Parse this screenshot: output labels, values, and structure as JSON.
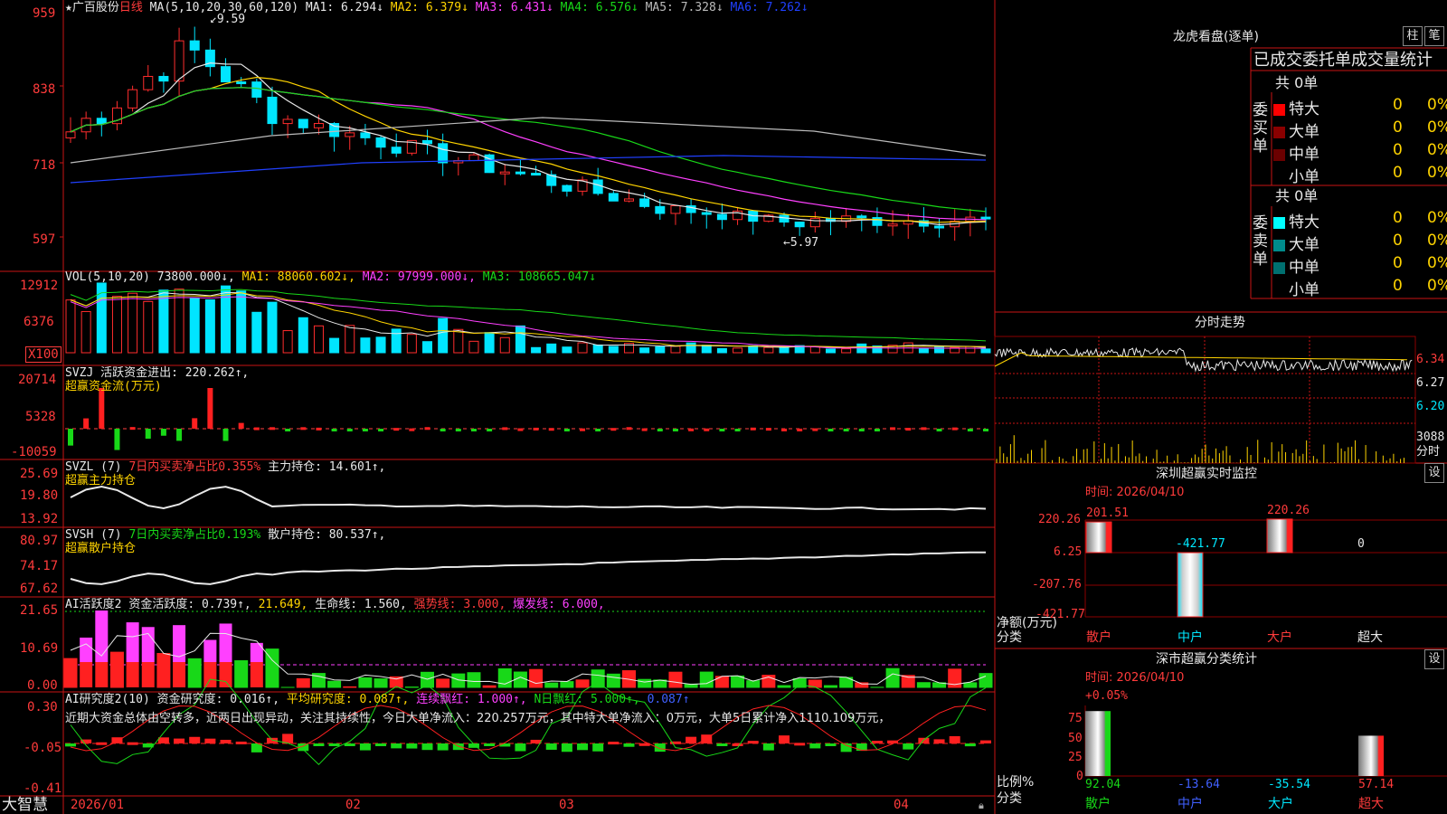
{
  "stock": {
    "name": "★广百股份",
    "period": "日线"
  },
  "main_legend": {
    "ma_label": "MA(5,10,20,30,60,120)",
    "items": [
      {
        "text": "MA1: 6.294↓",
        "color": "#e8e8e8"
      },
      {
        "text": "MA2: 6.379↓",
        "color": "#ffd400"
      },
      {
        "text": "MA3: 6.431↓",
        "color": "#ff40ff"
      },
      {
        "text": "MA4: 6.576↓",
        "color": "#18d818"
      },
      {
        "text": "MA5: 7.328↓",
        "color": "#bbbbbb"
      },
      {
        "text": "MA6: 7.262↓",
        "color": "#2040ff"
      }
    ]
  },
  "price_axis": [
    "959",
    "838",
    "718",
    "597"
  ],
  "price_annotations": {
    "high": "9.59",
    "low": "5.97"
  },
  "vol": {
    "axis": [
      "12912",
      "6376",
      "X100"
    ],
    "legend": [
      {
        "text": "VOL(5,10,20)",
        "color": "#e8e8e8"
      },
      {
        "text": "73800.000↓,",
        "color": "#e8e8e8"
      },
      {
        "text": "MA1: 88060.602↓,",
        "color": "#ffd400"
      },
      {
        "text": "MA2: 97999.000↓,",
        "color": "#ff40ff"
      },
      {
        "text": "MA3: 108665.047↓",
        "color": "#18d818"
      }
    ]
  },
  "svzj": {
    "axis": [
      "20714",
      "5328",
      "-10059"
    ],
    "line1": [
      {
        "text": "SVZJ  活跃资金进出: 220.262↑,",
        "color": "#e8e8e8"
      }
    ],
    "line2": "超赢资金流(万元)"
  },
  "svzl": {
    "axis": [
      "25.69",
      "19.80",
      "13.92"
    ],
    "line1": [
      {
        "text": "SVZL (7)",
        "color": "#e8e8e8"
      },
      {
        "text": "7日内买卖净占比0.355%",
        "color": "#ff3b3b"
      },
      {
        "text": "主力持仓: 14.601↑,",
        "color": "#e8e8e8"
      }
    ],
    "line2": "超赢主力持仓"
  },
  "svsh": {
    "axis": [
      "80.97",
      "74.17",
      "67.62"
    ],
    "line1": [
      {
        "text": "SVSH (7)",
        "color": "#e8e8e8"
      },
      {
        "text": "7日内买卖净占比0.193%",
        "color": "#18d818"
      },
      {
        "text": "散户持仓: 80.537↑,",
        "color": "#e8e8e8"
      }
    ],
    "line2": "超赢散户持仓"
  },
  "ai1": {
    "axis": [
      "21.65",
      "10.69",
      "0.00"
    ],
    "line1": [
      {
        "text": "AI活跃度2",
        "color": "#e8e8e8"
      },
      {
        "text": "资金活跃度: 0.739↑,",
        "color": "#e8e8e8"
      },
      {
        "text": "21.649,",
        "color": "#ffd400"
      },
      {
        "text": "生命线: 1.560,",
        "color": "#e8e8e8"
      },
      {
        "text": "强势线: 3.000,",
        "color": "#ff3b3b"
      },
      {
        "text": "爆发线: 6.000,",
        "color": "#ff40ff"
      }
    ]
  },
  "ai2": {
    "axis": [
      "0.30",
      "-0.05",
      "-0.41"
    ],
    "line1": [
      {
        "text": "AI研究度2(10)",
        "color": "#e8e8e8"
      },
      {
        "text": "资金研究度: 0.016↑,",
        "color": "#e8e8e8"
      },
      {
        "text": "平均研究度: 0.087↑,",
        "color": "#ffd400"
      },
      {
        "text": "连续飘红: 1.000↑,",
        "color": "#ff40ff"
      },
      {
        "text": "N日飘红: 5.000↑,",
        "color": "#18d818"
      },
      {
        "text": "0.087↑",
        "color": "#4060ff"
      }
    ],
    "comment": "近期大资金总体由空转多，近两日出现异动，关注其持续性，今日大单净流入：220.257万元，其中特大单净流入：0万元，大单5日累计净入1110.109万元，"
  },
  "bottom": {
    "brand": "大智慧",
    "dates": [
      "2026/01",
      "02",
      "03",
      "04"
    ]
  },
  "lhb": {
    "title": "龙虎看盘(逐单)",
    "btn1": "柱",
    "btn2": "笔",
    "header": "已成交委托单成交量统计",
    "buy": {
      "total": "共 0单",
      "side": "委买单",
      "rows": [
        {
          "label": "特大",
          "n": "0",
          "p": "0%"
        },
        {
          "label": "大单",
          "n": "0",
          "p": "0%"
        },
        {
          "label": "中单",
          "n": "0",
          "p": "0%"
        },
        {
          "label": "小单",
          "n": "0",
          "p": "0%"
        }
      ]
    },
    "sell": {
      "total": "共 0单",
      "side": "委卖单",
      "rows": [
        {
          "label": "特大",
          "n": "0",
          "p": "0%"
        },
        {
          "label": "大单",
          "n": "0",
          "p": "0%"
        },
        {
          "label": "中单",
          "n": "0",
          "p": "0%"
        },
        {
          "label": "小单",
          "n": "0",
          "p": "0%"
        }
      ]
    },
    "colors": {
      "buy": [
        "#ff0000",
        "#8b0000",
        "#6b0000",
        "#000000"
      ],
      "sell": [
        "#00ffff",
        "#008b8b",
        "#007070",
        "#000000"
      ]
    }
  },
  "intraday": {
    "title": "分时走势",
    "axis": [
      "6.34",
      "6.27",
      "6.20",
      "3088",
      "分时"
    ]
  },
  "sz_monitor": {
    "title": "深圳超赢实时监控",
    "btn": "设",
    "time": "时间: 2026/04/10",
    "axis": [
      "220.26",
      "6.25",
      "-207.76",
      "-421.77"
    ],
    "bars": [
      {
        "cat": "散户",
        "value": 201.51,
        "label": "201.51"
      },
      {
        "cat": "中户",
        "value": -421.77,
        "label": "-421.77"
      },
      {
        "cat": "大户",
        "value": 220.26,
        "label": "220.26"
      },
      {
        "cat": "超大",
        "value": 0,
        "label": "0"
      }
    ],
    "ylabel1": "净额(万元)",
    "ylabel2": "分类"
  },
  "sh_stats": {
    "title": "深市超赢分类统计",
    "btn": "设",
    "time": "时间: 2026/04/10",
    "top_label": "+0.05%",
    "axis": [
      "75",
      "50",
      "25",
      "0"
    ],
    "bars": [
      {
        "cat": "散户",
        "value": 92.04,
        "label": "92.04"
      },
      {
        "cat": "中户",
        "value": -13.64,
        "label": "-13.64"
      },
      {
        "cat": "大户",
        "value": -35.54,
        "label": "-35.54"
      },
      {
        "cat": "超大",
        "value": 57.14,
        "label": "57.14"
      }
    ],
    "ylabel1": "比例%",
    "ylabel2": "分类"
  },
  "chart_data": [
    {
      "type": "candlestick",
      "title": "广百股份 日线",
      "ylim": [
        5.97,
        9.59
      ],
      "x_range": [
        "2026/01",
        "2026/04/10"
      ],
      "annotations": {
        "max": 9.59,
        "min": 5.97
      },
      "series": [
        {
          "name": "MA1",
          "last": 6.294
        },
        {
          "name": "MA2",
          "last": 6.379
        },
        {
          "name": "MA3",
          "last": 6.431
        },
        {
          "name": "MA4",
          "last": 6.576
        },
        {
          "name": "MA5",
          "last": 7.328
        },
        {
          "name": "MA6",
          "last": 7.262
        }
      ]
    },
    {
      "type": "bar",
      "title": "深圳超赢实时监控",
      "categories": [
        "散户",
        "中户",
        "大户",
        "超大"
      ],
      "values": [
        201.51,
        -421.77,
        220.26,
        0
      ],
      "ylabel": "净额(万元)",
      "ylim": [
        -421.77,
        220.26
      ]
    },
    {
      "type": "bar",
      "title": "深市超赢分类统计",
      "categories": [
        "散户",
        "中户",
        "大户",
        "超大"
      ],
      "values": [
        92.04,
        -13.64,
        -35.54,
        57.14
      ],
      "ylabel": "比例%",
      "ylim": [
        0,
        100
      ]
    }
  ]
}
